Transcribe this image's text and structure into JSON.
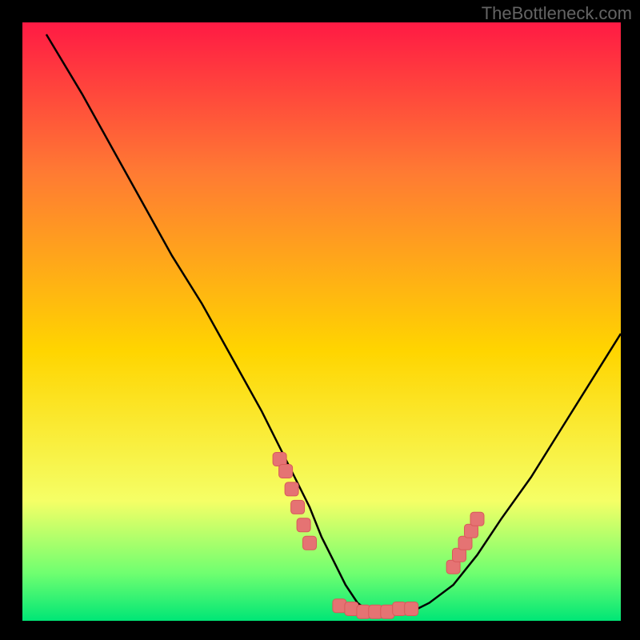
{
  "watermark": "TheBottleneck.com",
  "colors": {
    "background": "#000000",
    "gradient_top": "#ff1a44",
    "gradient_upper_mid": "#ff7a33",
    "gradient_mid": "#ffd500",
    "gradient_lower_mid": "#f5ff66",
    "gradient_bottom_band": "#70ff70",
    "gradient_bottom": "#00e676",
    "curve": "#000000",
    "marker_fill": "#e57373",
    "marker_stroke": "#d85a5a"
  },
  "chart_data": {
    "type": "line",
    "title": "",
    "xlabel": "",
    "ylabel": "",
    "xlim": [
      0,
      100
    ],
    "ylim": [
      0,
      100
    ],
    "x": [
      4,
      10,
      15,
      20,
      25,
      30,
      35,
      40,
      45,
      48,
      50,
      52,
      54,
      56,
      58,
      60,
      62,
      65,
      68,
      72,
      76,
      80,
      85,
      90,
      95,
      100
    ],
    "values": [
      98,
      88,
      79,
      70,
      61,
      53,
      44,
      35,
      25,
      19,
      14,
      10,
      6,
      3,
      1.5,
      1,
      1,
      1.5,
      3,
      6,
      11,
      17,
      24,
      32,
      40,
      48
    ],
    "markers": [
      {
        "x": 43,
        "y": 27
      },
      {
        "x": 44,
        "y": 25
      },
      {
        "x": 45,
        "y": 22
      },
      {
        "x": 46,
        "y": 19
      },
      {
        "x": 47,
        "y": 16
      },
      {
        "x": 48,
        "y": 13
      },
      {
        "x": 53,
        "y": 2.5
      },
      {
        "x": 55,
        "y": 2
      },
      {
        "x": 57,
        "y": 1.5
      },
      {
        "x": 59,
        "y": 1.5
      },
      {
        "x": 61,
        "y": 1.5
      },
      {
        "x": 63,
        "y": 2
      },
      {
        "x": 65,
        "y": 2
      },
      {
        "x": 72,
        "y": 9
      },
      {
        "x": 73,
        "y": 11
      },
      {
        "x": 74,
        "y": 13
      },
      {
        "x": 75,
        "y": 15
      },
      {
        "x": 76,
        "y": 17
      }
    ]
  }
}
